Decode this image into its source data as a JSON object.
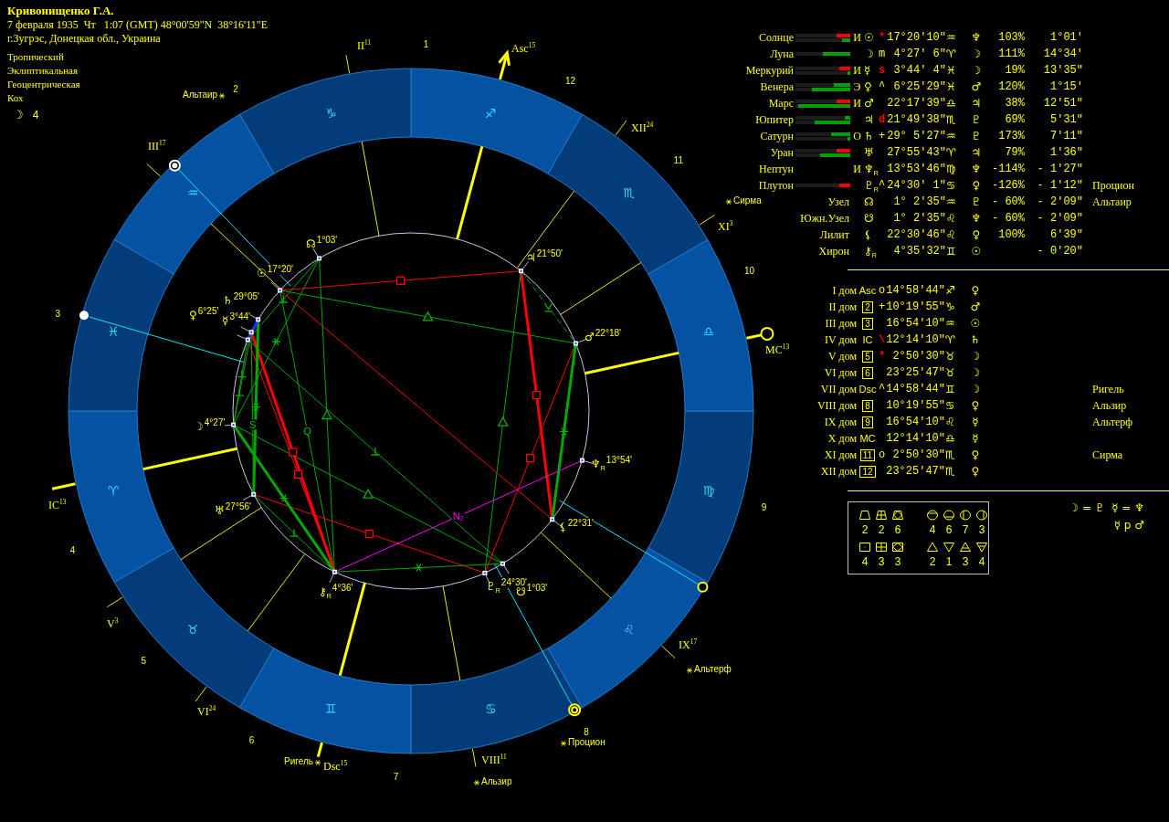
{
  "header": {
    "name": "Кривонищенко Г.А.",
    "datetime": "7 февраля 1935  Чт   1:07 (GMT) 48°00'59\"N  38°16'11\"E",
    "place": "г.Зугрэс, Донецкая обл., Украина"
  },
  "settings": [
    "Тропический",
    "Эклиптикальная",
    "Геоцентрическая",
    "Кох"
  ],
  "lunar_day": {
    "glyph": "☽",
    "value": "4"
  },
  "wheel": {
    "signs": [
      "♈",
      "♉",
      "♊",
      "♋",
      "♌",
      "♍",
      "♎",
      "♏",
      "♐",
      "♑",
      "♒",
      "♓"
    ],
    "house_numbers": [
      "1",
      "2",
      "3",
      "4",
      "5",
      "6",
      "7",
      "8",
      "9",
      "10",
      "11",
      "12"
    ],
    "cusps": [
      {
        "kind": "asc",
        "label": "Asc$^{15}$"
      },
      {
        "kind": "house",
        "label": "II$^{11}$"
      },
      {
        "kind": "house",
        "label": "III$^{17}$"
      },
      {
        "kind": "ic",
        "label": "IC$^{13}$"
      },
      {
        "kind": "house",
        "label": "V$^{3}$"
      },
      {
        "kind": "house",
        "label": "VI$^{24}$"
      },
      {
        "kind": "dsc",
        "label": "Dsc$^{15}$"
      },
      {
        "kind": "house",
        "label": "VIII$^{11}$"
      },
      {
        "kind": "house",
        "label": "IX$^{17}$"
      },
      {
        "kind": "mc",
        "label": "MC$^{13}$"
      },
      {
        "kind": "house",
        "label": "XI$^{3}$"
      },
      {
        "kind": "house",
        "label": "XII$^{24}$"
      }
    ],
    "planets": [
      {
        "glyph": "☉",
        "degree": "17°20'"
      },
      {
        "glyph": "☽",
        "degree": "4°27'"
      },
      {
        "glyph": "☿",
        "degree": "3°44'"
      },
      {
        "glyph": "♀",
        "degree": "6°25'"
      },
      {
        "glyph": "♂",
        "degree": "22°18'"
      },
      {
        "glyph": "♃",
        "degree": "21°50'"
      },
      {
        "glyph": "♄",
        "degree": "29°05'"
      },
      {
        "glyph": "♅",
        "degree": "27°56'"
      },
      {
        "glyph": "♆$_{R}$",
        "degree": "13°54'"
      },
      {
        "glyph": "♇$_{R}$",
        "degree": "24°30'"
      },
      {
        "glyph": "☊",
        "degree": "1°03'"
      },
      {
        "glyph": "☋",
        "degree": "1°03'"
      },
      {
        "glyph": "⚸",
        "degree": "22°31'"
      },
      {
        "glyph": "⚷$_{R}$",
        "degree": "4°36'"
      }
    ],
    "aspects": [
      {
        "kind": "square"
      },
      {
        "kind": "opposition"
      },
      {
        "kind": "trine"
      },
      {
        "kind": "lettered",
        "marker": "Q"
      },
      {
        "kind": "sextile"
      },
      {
        "kind": "trine"
      },
      {
        "kind": "decile"
      },
      {
        "kind": "bold-square"
      },
      {
        "kind": "square"
      },
      {
        "kind": "square"
      },
      {
        "kind": "bold-sextile"
      },
      {
        "kind": "trine"
      },
      {
        "kind": "decile"
      },
      {
        "kind": "decile"
      },
      {
        "kind": "bold-sextile"
      },
      {
        "kind": "lettered",
        "marker": "S"
      },
      {
        "kind": "decile"
      },
      {
        "kind": "decile"
      },
      {
        "kind": "semisextile"
      },
      {
        "kind": "bold-square"
      },
      {
        "kind": "trine"
      },
      {
        "kind": "square"
      },
      {
        "kind": "bold-sextile"
      },
      {
        "kind": "novile",
        "marker": "N₂"
      },
      {
        "kind": "sextile"
      },
      {
        "kind": "bold-conjunction"
      }
    ],
    "ring_marks": [
      {
        "kind": "ring-dot",
        "color": "#ffffff"
      },
      {
        "kind": "dot",
        "color": "#ffffff"
      },
      {
        "kind": "ring",
        "color": "#ffff00"
      },
      {
        "kind": "double-ring",
        "color": "#ffff00"
      }
    ],
    "stars": [
      "Альтаир",
      "Сирма",
      "Альтерф",
      "Процион",
      "Ригель",
      "Альзир"
    ]
  },
  "planets_table": {
    "rows": [
      {
        "kind": "planet",
        "name": "Солнце",
        "bars": [
          {
            "color": "#ff0000",
            "level": 0.25
          },
          {
            "color": "#00a000",
            "level": 0.15
          }
        ],
        "status": "И",
        "glyph": "☉",
        "mark": {
          "text": "*",
          "highlighted": true
        },
        "position": "17°20'10\"",
        "sign": "♒",
        "ruler": "♆",
        "percent": "103%",
        "speed": "1°01'"
      },
      {
        "kind": "planet",
        "name": "Луна",
        "bars": [
          {
            "color": "#00a000",
            "level": 0.5
          }
        ],
        "glyph": "☽",
        "mark": {
          "text": "m",
          "highlighted": false
        },
        "position": "4°27' 6\"",
        "sign": "♈",
        "ruler": "☽",
        "percent": "111%",
        "speed": "14°34'"
      },
      {
        "kind": "planet",
        "name": "Меркурий",
        "bars": [
          {
            "color": "#ff0000",
            "level": 0.2
          },
          {
            "color": "#00a000",
            "level": 0.05
          }
        ],
        "status": "И",
        "glyph": "☿",
        "mark": {
          "text": "s",
          "highlighted": true
        },
        "position": "3°44' 4\"",
        "sign": "♓",
        "ruler": "☽",
        "percent": "19%",
        "speed": "13'35\""
      },
      {
        "kind": "planet",
        "name": "Венера",
        "bars": [
          {
            "color": "#00a000",
            "level": 0.3
          },
          {
            "color": "#00a000",
            "level": 0.7
          }
        ],
        "status": "Э",
        "glyph": "♀",
        "mark": {
          "text": "^",
          "highlighted": false
        },
        "position": "6°25'29\"",
        "sign": "♓",
        "ruler": "♂",
        "percent": "120%",
        "speed": "1°15'"
      },
      {
        "kind": "planet",
        "name": "Марс",
        "bars": [
          {
            "color": "#ff0000",
            "level": 0.25
          },
          {
            "color": "#00a000",
            "level": 0.95
          }
        ],
        "status": "И",
        "glyph": "♂",
        "position": "22°17'39\"",
        "sign": "♎",
        "ruler": "♃",
        "percent": "38%",
        "speed": "12'51\""
      },
      {
        "kind": "planet",
        "name": "Юпитер",
        "bars": [
          {
            "color": "#00a000",
            "level": 0.1
          },
          {
            "color": "#00a000",
            "level": 0.65
          }
        ],
        "glyph": "♃",
        "mark": {
          "text": "d",
          "highlighted": true
        },
        "position": "21°49'38\"",
        "sign": "♏",
        "ruler": "♇",
        "percent": "69%",
        "speed": "5'31\""
      },
      {
        "kind": "planet",
        "name": "Сатурн",
        "bars": [
          {
            "color": "#00a000",
            "level": 0.35
          },
          {
            "color": "#00a000",
            "level": 0.05
          }
        ],
        "status": "О",
        "glyph": "♄",
        "mark": {
          "text": "+",
          "highlighted": false
        },
        "position": "29° 5'27\"",
        "sign": "♒",
        "ruler": "♇",
        "percent": "173%",
        "speed": "7'11\""
      },
      {
        "kind": "planet",
        "name": "Уран",
        "bars": [
          {
            "color": "#ff0000",
            "level": 0.25
          },
          {
            "color": "#00a000",
            "level": 0.55
          }
        ],
        "glyph": "♅",
        "position": "27°55'43\"",
        "sign": "♈",
        "ruler": "♃",
        "percent": "79%",
        "speed": "1'36\""
      },
      {
        "kind": "planet",
        "name": "Нептун",
        "status": "И",
        "glyph": "♆$_{R}$",
        "position": "13°53'46\"",
        "sign": "♍",
        "ruler": "♆",
        "percent": "-114%",
        "speed": "- 1'27\""
      },
      {
        "kind": "planet",
        "name": "Плутон",
        "bars": [
          {
            "color": "#ff0000",
            "level": 0.2
          }
        ],
        "glyph": "♇$_{R}$",
        "mark": {
          "text": "^",
          "highlighted": false
        },
        "position": "24°30' 1\"",
        "sign": "♋",
        "ruler": "♀",
        "percent": "-126%",
        "speed": "- 1'12\"",
        "star": "Процион"
      },
      {
        "kind": "point",
        "name": "Узел",
        "glyph": "☊",
        "position": "1° 2'35\"",
        "sign": "♒",
        "ruler": "♇",
        "percent": "- 60%",
        "speed": "- 2'09\"",
        "star": "Альтаир"
      },
      {
        "kind": "point",
        "name": "Южн.Узел",
        "glyph": "☋",
        "position": "1° 2'35\"",
        "sign": "♌",
        "ruler": "♆",
        "percent": "- 60%",
        "speed": "- 2'09\""
      },
      {
        "kind": "point",
        "name": "Лилит",
        "glyph": "⚸",
        "position": "22°30'46\"",
        "sign": "♌",
        "ruler": "♀",
        "percent": "100%",
        "speed": "6'39\""
      },
      {
        "kind": "point",
        "name": "Хирон",
        "glyph": "⚷$_{R}$",
        "position": "4°35'32\"",
        "sign": "♊",
        "ruler": "☉",
        "speed": "- 0'20\""
      }
    ]
  },
  "houses_table": {
    "rows": [
      {
        "name": "I дом",
        "kind": "angle",
        "point": "Asc",
        "mark": {
          "text": "o",
          "highlighted": false
        },
        "position": "14°58'44\"",
        "sign": "♐",
        "ruler": "♀"
      },
      {
        "name": "II дом",
        "kind": "house",
        "point": "2",
        "mark": {
          "text": "+",
          "highlighted": false
        },
        "position": "10°19'55\"",
        "sign": "♑",
        "ruler": "♂"
      },
      {
        "name": "III дом",
        "kind": "house",
        "point": "3",
        "position": "16°54'10\"",
        "sign": "♒",
        "ruler": "☉"
      },
      {
        "name": "IV дом",
        "kind": "angle",
        "point": "IC",
        "mark": {
          "text": "\\",
          "highlighted": true
        },
        "position": "12°14'10\"",
        "sign": "♈",
        "ruler": "♄"
      },
      {
        "name": "V дом",
        "kind": "house",
        "point": "5",
        "mark": {
          "text": "*",
          "highlighted": true
        },
        "position": "2°50'30\"",
        "sign": "♉",
        "ruler": "☽"
      },
      {
        "name": "VI дом",
        "kind": "house",
        "point": "6",
        "position": "23°25'47\"",
        "sign": "♉",
        "ruler": "☽"
      },
      {
        "name": "VII дом",
        "kind": "angle",
        "point": "Dsc",
        "mark": {
          "text": "^",
          "highlighted": false
        },
        "position": "14°58'44\"",
        "sign": "♊",
        "ruler": "☽",
        "star": "Ригель"
      },
      {
        "name": "VIII дом",
        "kind": "house",
        "point": "8",
        "position": "10°19'55\"",
        "sign": "♋",
        "ruler": "♀",
        "star": "Альзир"
      },
      {
        "name": "IX дом",
        "kind": "house",
        "point": "9",
        "position": "16°54'10\"",
        "sign": "♌",
        "ruler": "☿",
        "star": "Альтерф"
      },
      {
        "name": "X дом",
        "kind": "angle",
        "point": "MC",
        "position": "12°14'10\"",
        "sign": "♎",
        "ruler": "☿"
      },
      {
        "name": "XI дом",
        "kind": "house",
        "point": "11",
        "mark": {
          "text": "o",
          "highlighted": false
        },
        "position": "2°50'30\"",
        "sign": "♏",
        "ruler": "♀",
        "star": "Сирма"
      },
      {
        "name": "XII дом",
        "kind": "house",
        "point": "12",
        "position": "23°25'47\"",
        "sign": "♏",
        "ruler": "♀"
      }
    ]
  },
  "balance": {
    "rows": [
      {
        "cells": [
          {
            "kind": "trapezoid",
            "value": "2"
          },
          {
            "kind": "trapezoid-cross",
            "value": "2"
          },
          {
            "kind": "trapezoid-diamond",
            "value": "6"
          },
          {
            "kind": "circle-top",
            "value": "4"
          },
          {
            "kind": "circle-bottom",
            "value": "6"
          },
          {
            "kind": "circle-left",
            "value": "7"
          },
          {
            "kind": "circle-right",
            "value": "3"
          }
        ]
      },
      {
        "cells": [
          {
            "kind": "square-dot",
            "value": "4"
          },
          {
            "kind": "square-cross",
            "value": "3"
          },
          {
            "kind": "square-diamond",
            "value": "3"
          },
          {
            "kind": "fire",
            "value": "2"
          },
          {
            "kind": "water",
            "value": "1"
          },
          {
            "kind": "air",
            "value": "3"
          },
          {
            "kind": "earth",
            "value": "4"
          }
        ]
      }
    ]
  },
  "notes": [
    "☽ = ♇  ☿ = ♆",
    "☿ p ♂"
  ]
}
